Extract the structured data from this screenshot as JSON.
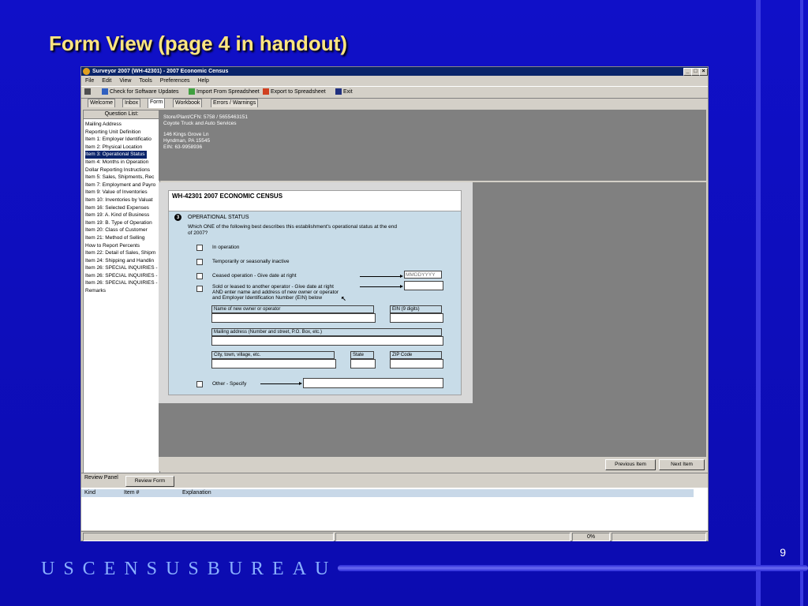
{
  "slide": {
    "title": "Form View (page 4 in handout)",
    "page_number": "9",
    "footer_brand": "USCENSUSBUREAU"
  },
  "window": {
    "title": "Surveyor 2007 (WH-42301) - 2007 Economic Census",
    "controls": [
      "_",
      "□",
      "×"
    ]
  },
  "menu": [
    "File",
    "Edit",
    "View",
    "Tools",
    "Preferences",
    "Help"
  ],
  "toolbar": {
    "check_updates": "Check for Software Updates",
    "import": "Import From Spreadsheet",
    "export": "Export to Spreadsheet",
    "exit": "Exit"
  },
  "tabs": [
    "Welcome",
    "Inbox",
    "Form",
    "Workbook",
    "Errors / Warnings"
  ],
  "question_list": {
    "header": "Question List:",
    "items": [
      "Mailing Address",
      "Reporting Unit Definition",
      "Item 1: Employer Identificatio",
      "Item 2: Physical Location",
      "Item 3: Operational Status",
      "Item 4: Months in Operation",
      "Dollar Reporting Instructions",
      "Item 5: Sales, Shipments, Rec",
      "Item 7: Employment and Payro",
      "Item 9: Value of Inventories",
      "Item 10: Inventories by Valuat",
      "Item 16: Selected Expenses",
      "Item 19: A. Kind of Business",
      "Item 19: B. Type of Operation",
      "Item 20: Class of Customer",
      "Item 21: Method of Selling",
      "How to Report Percents",
      "Item 22: Detail of Sales, Shipm",
      "Item 24: Shipping and Handlin",
      "Item 26: SPECIAL INQUIRIES -",
      "Item 26: SPECIAL INQUIRIES -",
      "Item 26: SPECIAL INQUIRIES -",
      "Remarks"
    ],
    "selected_index": 4
  },
  "info": {
    "line1": "Store/Plant/CFN: 5758 / 5655463151",
    "line2": "Coyote Truck and Auto Services",
    "line3": "146 Kings Grove Ln",
    "line4": "Hyndman, PA 15545",
    "line5": "EIN: 63-9958936"
  },
  "form": {
    "header": "WH-42301 2007 ECONOMIC CENSUS",
    "item_number": "3",
    "section_title": "OPERATIONAL STATUS",
    "question_line1": "Which ONE of the following best describes this establishment's operational status at the end",
    "question_line2": "of 2007?",
    "opt_in_operation": "In operation",
    "opt_temporarily": "Temporarily or seasonally inactive",
    "opt_ceased": "Ceased operation - Give date at right",
    "date_placeholder": "MMDDYYYY",
    "opt_sold_line1": "Sold or leased to another operator - Give date at right",
    "opt_sold_line2": "AND enter name and address of new owner or operator",
    "opt_sold_line3": "and Employer Identification Number (EIN) below",
    "lbl_name": "Name of new owner or operator",
    "lbl_ein": "EIN (9 digits)",
    "lbl_mailing": "Mailing address (Number and street, P.O. Box, etc.)",
    "lbl_city": "City, town, village, etc.",
    "lbl_state": "State",
    "lbl_zip": "ZIP Code",
    "opt_other": "Other - Specify"
  },
  "nav": {
    "previous": "Previous Item",
    "next": "Next Item"
  },
  "review": {
    "panel_label": "Review Panel",
    "form_tab": "Review Form",
    "col_kind": "Kind",
    "col_item": "Item #",
    "col_explanation": "Explanation"
  },
  "status": {
    "percent": "0%"
  }
}
